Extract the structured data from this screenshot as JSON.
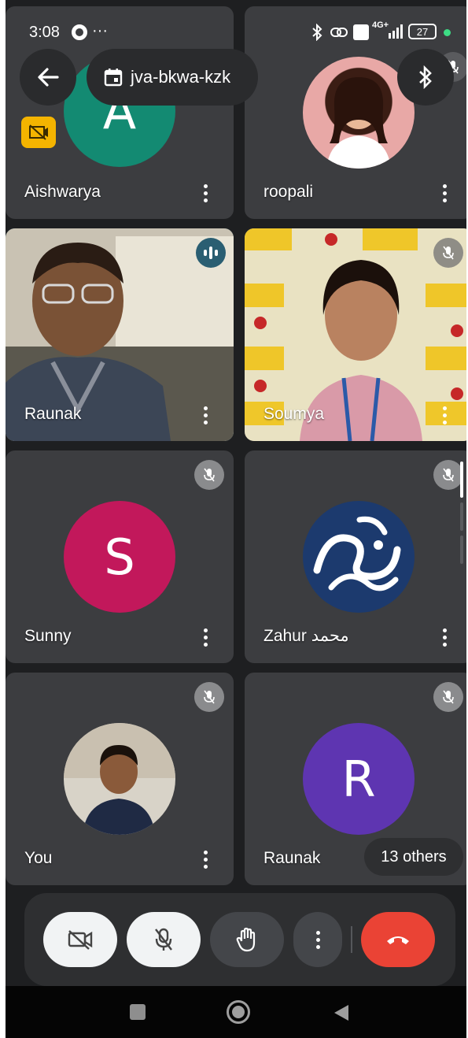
{
  "status_bar": {
    "time": "3:08",
    "dots": "···",
    "icon_names": [
      "bluetooth-icon",
      "link-icon",
      "volte-icon",
      "4g-signal-icon",
      "battery-icon"
    ],
    "network_label": "4G+",
    "battery": "27"
  },
  "header": {
    "back_label": "Back",
    "meeting_code": "jva-bkwa-kzk"
  },
  "participants": [
    {
      "name": "Aishwarya",
      "initial": "A",
      "avatar_color": "#138a72",
      "type": "avatar",
      "muted": false
    },
    {
      "name": "roopali",
      "type": "photo",
      "muted": true
    },
    {
      "name": "Raunak",
      "type": "video",
      "speaking": true
    },
    {
      "name": "Soumya",
      "type": "video",
      "muted": true
    },
    {
      "name": "Sunny",
      "initial": "S",
      "avatar_color": "#c2185b",
      "type": "avatar",
      "muted": true
    },
    {
      "name": "Zahur محمد",
      "type": "photo",
      "muted": true
    },
    {
      "name": "You",
      "type": "photo",
      "muted": true
    },
    {
      "name": "Raunak",
      "initial": "R",
      "avatar_color": "#5e35b1",
      "type": "avatar",
      "muted": true
    }
  ],
  "others_badge": "13 others",
  "controls": {
    "camera_state": "off",
    "mic_state": "off",
    "hangup_color": "#ea4335"
  },
  "colors": {
    "background": "#1e1f21",
    "tile": "#3c3d40",
    "accent_speaking": "#2a5e72"
  }
}
